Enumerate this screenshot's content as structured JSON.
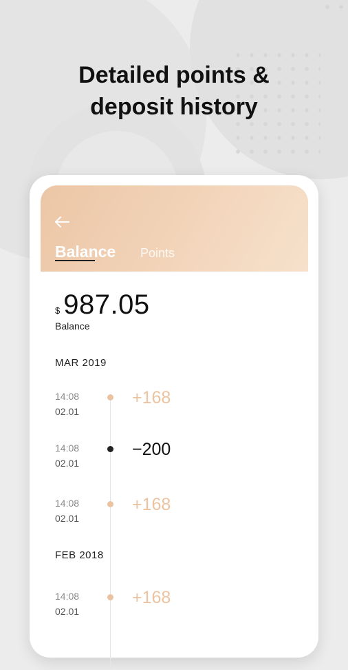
{
  "headline": {
    "line1": "Detailed points &",
    "line2": "deposit history"
  },
  "header": {
    "back_icon": "arrow-left-icon",
    "tabs": [
      {
        "label": "Balance",
        "active": true
      },
      {
        "label": "Points",
        "active": false
      }
    ]
  },
  "balance": {
    "currency": "$",
    "amount": "987.05",
    "label": "Balance"
  },
  "groups": [
    {
      "month": "MAR 2019",
      "transactions": [
        {
          "time": "14:08",
          "date": "02.01",
          "amount": "+168",
          "type": "credit"
        },
        {
          "time": "14:08",
          "date": "02.01",
          "amount": "−200",
          "type": "debit"
        },
        {
          "time": "14:08",
          "date": "02.01",
          "amount": "+168",
          "type": "credit"
        }
      ]
    },
    {
      "month": "FEB 2018",
      "transactions": [
        {
          "time": "14:08",
          "date": "02.01",
          "amount": "+168",
          "type": "credit"
        }
      ]
    }
  ],
  "colors": {
    "accent": "#ecc3a1",
    "debit": "#111111",
    "header_gradient_start": "#ecc6a6",
    "header_gradient_end": "#f6e1cc"
  }
}
